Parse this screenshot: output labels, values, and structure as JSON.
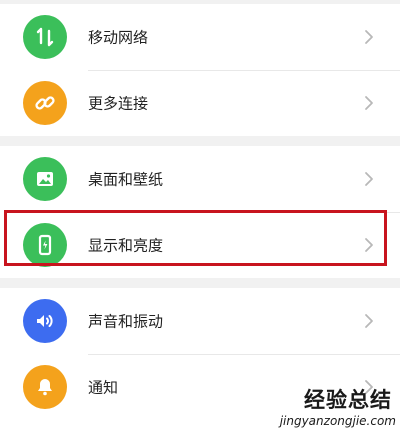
{
  "groups": [
    {
      "items": [
        {
          "label": "移动网络",
          "icon": "signal-arrows-icon",
          "color": "#3bbf5a"
        },
        {
          "label": "更多连接",
          "icon": "link-icon",
          "color": "#f4a21c"
        }
      ]
    },
    {
      "items": [
        {
          "label": "桌面和壁纸",
          "icon": "image-icon",
          "color": "#3bbf5a"
        },
        {
          "label": "显示和亮度",
          "icon": "phone-display-icon",
          "color": "#3bbf5a"
        }
      ]
    },
    {
      "items": [
        {
          "label": "声音和振动",
          "icon": "speaker-icon",
          "color": "#3d6cf0"
        },
        {
          "label": "通知",
          "icon": "bell-icon",
          "color": "#f4a21c"
        }
      ]
    }
  ],
  "watermark": {
    "brand": "经验总结",
    "url": "jingyanzongjie.com"
  },
  "highlight_color": "#c8141e"
}
